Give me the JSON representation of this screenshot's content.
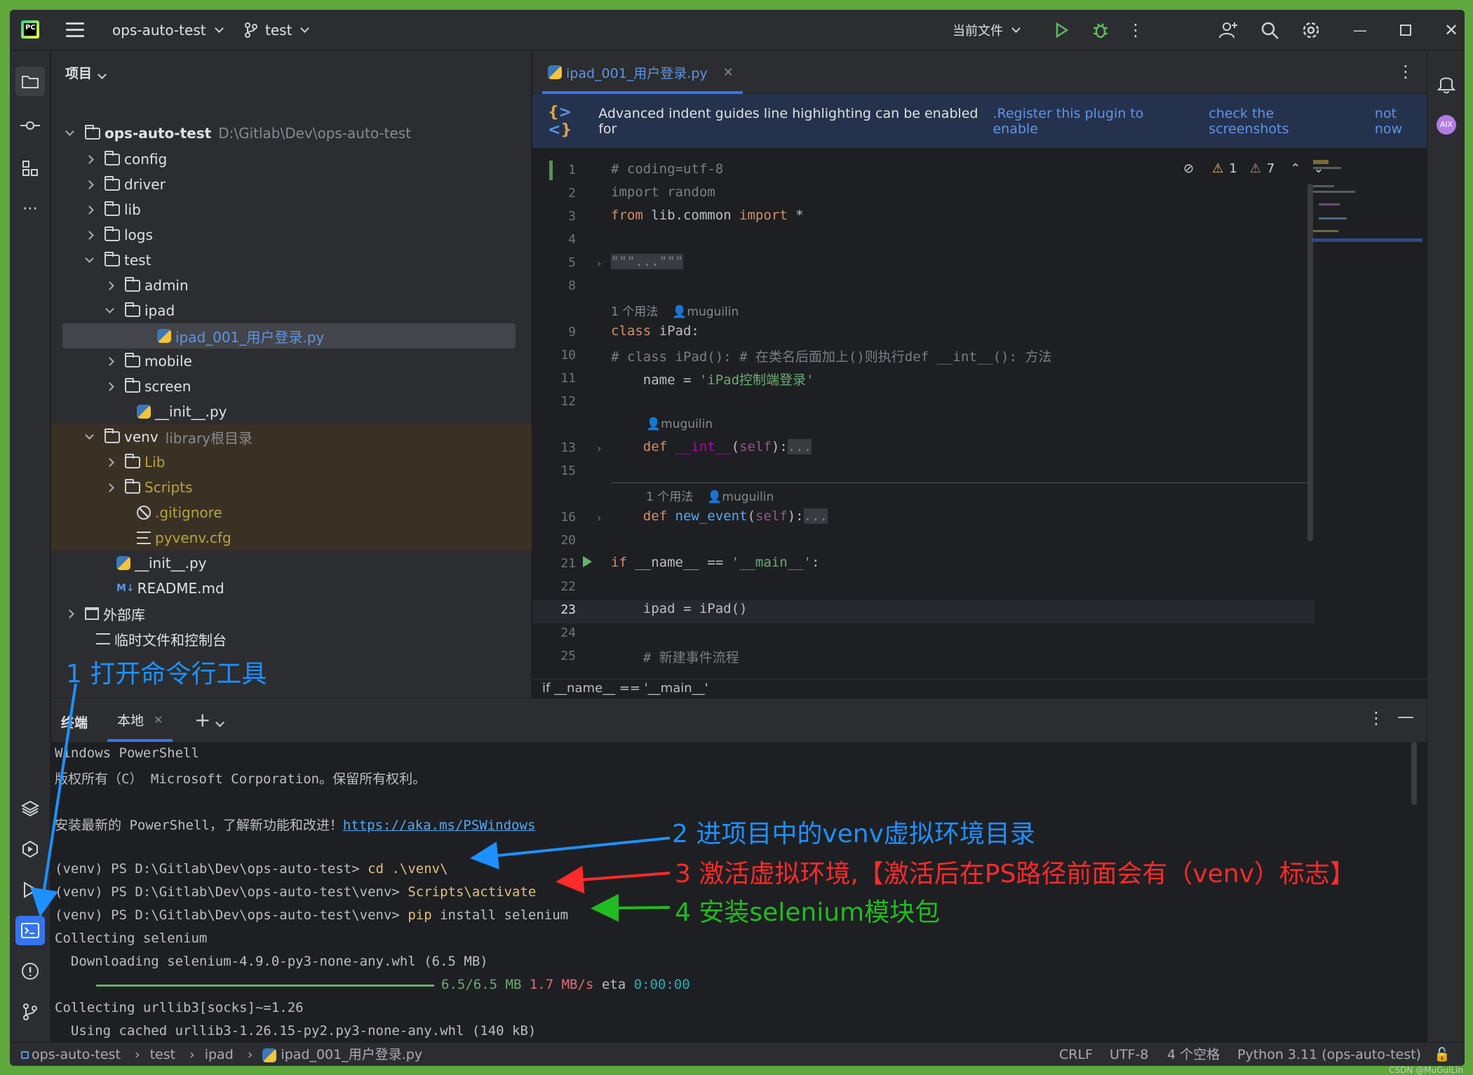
{
  "titlebar": {
    "project_name": "ops-auto-test",
    "branch": "test",
    "run_config": "当前文件"
  },
  "project_pane": {
    "title": "项目",
    "root": {
      "name": "ops-auto-test",
      "path": "D:\\Gitlab\\Dev\\ops-auto-test"
    },
    "items": [
      {
        "label": "config"
      },
      {
        "label": "driver"
      },
      {
        "label": "lib"
      },
      {
        "label": "logs"
      },
      {
        "label": "test"
      },
      {
        "label": "admin"
      },
      {
        "label": "ipad"
      },
      {
        "label": "ipad_001_用户登录.py"
      },
      {
        "label": "mobile"
      },
      {
        "label": "screen"
      },
      {
        "label": "__init__.py"
      },
      {
        "label": "venv",
        "hint": "library根目录"
      },
      {
        "label": "Lib"
      },
      {
        "label": "Scripts"
      },
      {
        "label": ".gitignore"
      },
      {
        "label": "pyvenv.cfg"
      },
      {
        "label": "__init__.py"
      },
      {
        "label": "README.md"
      },
      {
        "label": "外部库"
      },
      {
        "label": "临时文件和控制台"
      }
    ]
  },
  "editor": {
    "tab_label": "ipad_001_用户登录.py",
    "banner": {
      "text": "Advanced indent guides line highlighting can be enabled for",
      "link_register": ".Register this plugin to enable",
      "link_screens": "check the screenshots",
      "link_dismiss": "not now"
    },
    "inspections": {
      "warn1": "1",
      "warn2": "7"
    },
    "hints": {
      "usage": "1 个用法",
      "author": "muguilin"
    },
    "lines": [
      {
        "n": "1",
        "text": "# coding=utf-8"
      },
      {
        "n": "2",
        "text": "import random"
      },
      {
        "n": "3",
        "kw1": "from",
        "mid": " lib.common ",
        "kw2": "import",
        "tail": " *"
      },
      {
        "n": "4",
        "text": ""
      },
      {
        "n": "5",
        "text": "\"\"\"...\"\"\""
      },
      {
        "n": "8",
        "text": ""
      },
      {
        "n": "9",
        "kw": "class",
        "tail": " iPad:"
      },
      {
        "n": "10",
        "text": "# class iPad(): # 在类名后面加上()则执行def __int__(): 方法"
      },
      {
        "n": "11",
        "pre": "    name = ",
        "str": "'iPad控制端登录'"
      },
      {
        "n": "12",
        "text": ""
      },
      {
        "n": "13",
        "kw": "def",
        "fn": "__int__",
        "self": "self",
        "tail": "..."
      },
      {
        "n": "15",
        "text": ""
      },
      {
        "n": "16",
        "kw": "def",
        "fn": "new_event",
        "self": "self",
        "tail": "..."
      },
      {
        "n": "20",
        "text": ""
      },
      {
        "n": "21",
        "kw": "if",
        "mid": " __name__ == ",
        "str": "'__main__'",
        "tail": ":"
      },
      {
        "n": "22",
        "text": ""
      },
      {
        "n": "23",
        "text": "    ipad = iPad()"
      },
      {
        "n": "24",
        "text": ""
      },
      {
        "n": "25",
        "text": "    # 新建事件流程"
      }
    ],
    "breadcrumb": "if __name__ == '__main__'"
  },
  "terminal": {
    "title": "终端",
    "tab": "本地",
    "lines": {
      "l1": "Windows PowerShell",
      "l2": "版权所有（C） Microsoft Corporation。保留所有权利。",
      "l3_pre": "安装最新的 PowerShell，了解新功能和改进！",
      "l3_link": "https://aka.ms/PSWindows",
      "p1": "(venv) PS D:\\Gitlab\\Dev\\ops-auto-test> ",
      "c1": "cd .\\venv\\",
      "p2": "(venv) PS D:\\Gitlab\\Dev\\ops-auto-test\\venv> ",
      "c2": "Scripts\\activate",
      "p3": "(venv) PS D:\\Gitlab\\Dev\\ops-auto-test\\venv> ",
      "c3a": "pip",
      "c3b": " install selenium",
      "l7": "Collecting selenium",
      "l8": "  Downloading selenium-4.9.0-py3-none-any.whl (6.5 MB)",
      "l9_size": "6.5/6.5 MB",
      "l9_speed": "1.7 MB/s",
      "l9_eta": "eta",
      "l9_time": "0:00:00",
      "l10": "Collecting urllib3[socks]~=1.26",
      "l11": "  Using cached urllib3-1.26.15-py2.py3-none-any.whl (140 kB)"
    }
  },
  "statusbar": {
    "crumbs": [
      "ops-auto-test",
      "test",
      "ipad",
      "ipad_001_用户登录.py"
    ],
    "line_sep": "CRLF",
    "encoding": "UTF-8",
    "indent": "4 个空格",
    "interpreter": "Python 3.11 (ops-auto-test)"
  },
  "annotations": {
    "a1": "1 打开命令行工具",
    "a2": "2 进项目中的venv虚拟环境目录",
    "a3": "3 激活虚拟环境,【激活后在PS路径前面会有（venv）标志】",
    "a4": "4 安装selenium模块包",
    "colors": {
      "blue": "#1e90ff",
      "red": "#ff2a2a",
      "green": "#22bb22"
    }
  },
  "watermark": "CSDN @MuGuiLin"
}
